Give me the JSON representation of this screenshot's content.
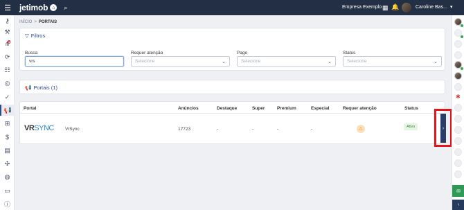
{
  "header": {
    "logo_text": "jetimob",
    "company": "Empresa Exemplo",
    "user_name": "Caroline Bas..."
  },
  "breadcrumb": {
    "home": "INÍCIO",
    "separator": ">",
    "current": "PORTAIS"
  },
  "filters": {
    "title": "Filtros",
    "search": {
      "label": "Busca",
      "value": "vrs"
    },
    "requer_atencao": {
      "label": "Requer atenção",
      "selected": "Selecione"
    },
    "pago": {
      "label": "Pago",
      "selected": "Selecione"
    },
    "status": {
      "label": "Status",
      "selected": "Selecione"
    }
  },
  "portals": {
    "title": "Portais (1)",
    "columns": [
      "Portal",
      "Anúncios",
      "Destaque",
      "Super",
      "Premium",
      "Especial",
      "Requer atenção",
      "Status"
    ],
    "rows": [
      {
        "logo_vr": "VR",
        "logo_sync": "SYNC",
        "name": "VrSync",
        "anuncios": "17723",
        "destaque": "-",
        "super": "-",
        "premium": "-",
        "especial": "-",
        "requer_atencao_icon": "warning-icon",
        "status": "Ativo"
      }
    ]
  },
  "colors": {
    "topbar": "#232f45",
    "accent": "#2a4b8d",
    "status_active": "#3a8a3a",
    "warning": "#e8943a",
    "highlight": "#e3141b"
  }
}
